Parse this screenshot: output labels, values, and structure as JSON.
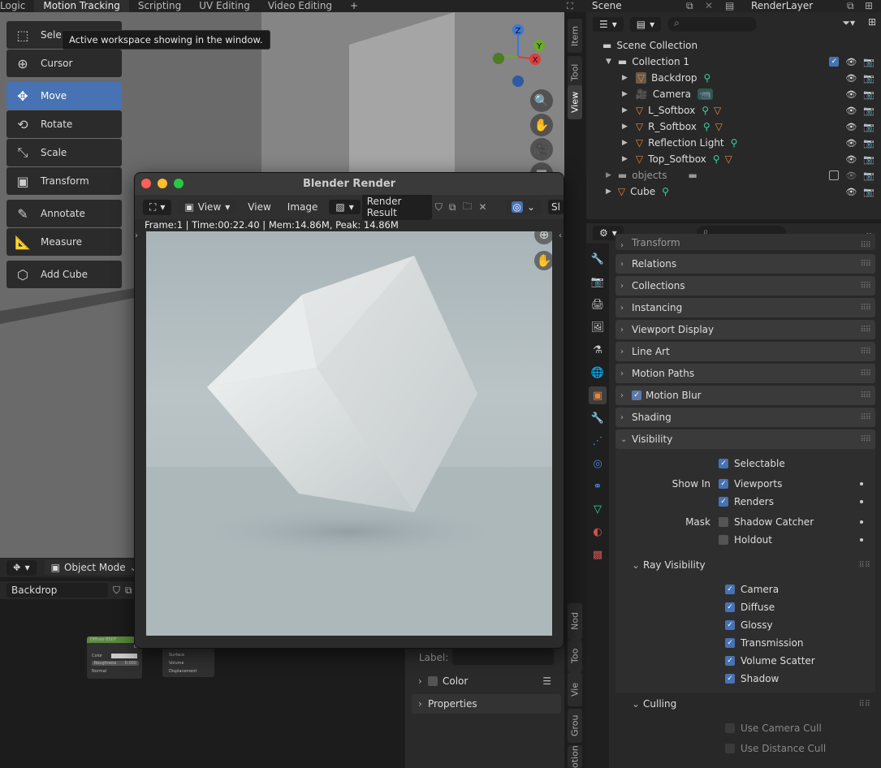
{
  "workspace_tabs": [
    "Logic",
    "Motion Tracking",
    "Scripting",
    "UV Editing",
    "Video Editing"
  ],
  "active_workspace": "Motion Tracking",
  "add_workspace_symbol": "+",
  "scene": {
    "name": "Scene",
    "layer": "RenderLayer"
  },
  "tooltip": "Active workspace showing in the window.",
  "viewport_label_fragment": "rop",
  "toolbar": {
    "select": "Sele",
    "cursor": "Cursor",
    "move": "Move",
    "rotate": "Rotate",
    "scale": "Scale",
    "transform": "Transform",
    "annotate": "Annotate",
    "measure": "Measure",
    "add_cube": "Add Cube"
  },
  "side_tabs": [
    "Item",
    "Tool",
    "View"
  ],
  "gizmo_axes": {
    "z": "Z",
    "y": "Y",
    "x": "X"
  },
  "viewport_header": {
    "mode": "Object Mode"
  },
  "node_header": {
    "object": "Backdrop"
  },
  "node_editor": {
    "node_title": "Diffuse BSDF",
    "node_fields": [
      "Color",
      "Roughness",
      "Normal"
    ],
    "roughness_value": "0.000",
    "output_fields": [
      "Surface",
      "Volume",
      "Displacement"
    ],
    "node_value_fragment": "BS",
    "side_tabs": [
      "Nod",
      "Too",
      "Vie",
      "Grou",
      "otion"
    ],
    "label_caption": "Label:",
    "color_panel": "Color",
    "properties_panel": "Properties"
  },
  "outliner": {
    "root": "Scene Collection",
    "collection": "Collection 1",
    "items": [
      "Backdrop",
      "Camera",
      "L_Softbox",
      "R_Softbox",
      "Reflection Light",
      "Top_Softbox"
    ],
    "other_collection": "objects",
    "cube": "Cube"
  },
  "props": {
    "panels_top": [
      "Transform",
      "Relations",
      "Collections",
      "Instancing",
      "Viewport Display",
      "Line Art",
      "Motion Paths",
      "Motion Blur",
      "Shading"
    ],
    "visibility": "Visibility",
    "selectable": "Selectable",
    "show_in_label": "Show In",
    "viewports": "Viewports",
    "renders": "Renders",
    "mask_label": "Mask",
    "shadow_catcher": "Shadow Catcher",
    "holdout": "Holdout",
    "ray_visibility": "Ray Visibility",
    "rays": [
      "Camera",
      "Diffuse",
      "Glossy",
      "Transmission",
      "Volume Scatter",
      "Shadow"
    ],
    "culling": "Culling",
    "use_camera_cull": "Use Camera Cull",
    "use_distance_cull": "Use Distance Cull"
  },
  "render_window": {
    "title": "Blender Render",
    "menu_view": "View",
    "menu_view2": "View",
    "menu_image": "Image",
    "slot": "Render Result",
    "slot_fragment": "Sl",
    "stats": "Frame:1 | Time:00:22.40 | Mem:14.86M, Peak: 14.86M"
  },
  "colors": {
    "accent": "#4772b3",
    "x_axis": "#e03c3c",
    "y_axis": "#6aab2a",
    "z_axis": "#3c78d8",
    "object_orange": "#e5883c",
    "mesh_green": "#3ad1a0"
  }
}
